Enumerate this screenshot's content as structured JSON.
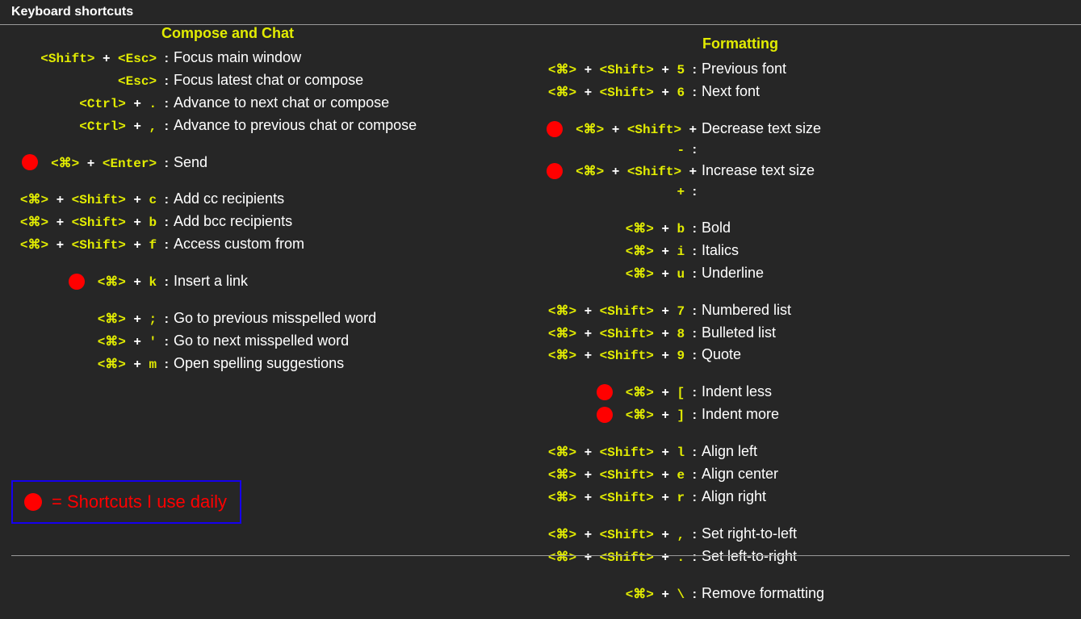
{
  "header": {
    "title": "Keyboard shortcuts"
  },
  "legend": {
    "text": "= Shortcuts I use daily"
  },
  "compose": {
    "title": "Compose and Chat",
    "g1": [
      {
        "daily": false,
        "keys": [
          "<Shift>",
          "<Esc>"
        ],
        "desc": "Focus main window"
      },
      {
        "daily": false,
        "keys": [
          "<Esc>"
        ],
        "desc": "Focus latest chat or compose"
      },
      {
        "daily": false,
        "keys": [
          "<Ctrl>",
          "."
        ],
        "desc": "Advance to next chat or compose"
      },
      {
        "daily": false,
        "keys": [
          "<Ctrl>",
          ","
        ],
        "desc": "Advance to previous chat or compose"
      }
    ],
    "g2": [
      {
        "daily": true,
        "keys": [
          "<⌘>",
          "<Enter>"
        ],
        "desc": "Send"
      }
    ],
    "g3": [
      {
        "daily": false,
        "keys": [
          "<⌘>",
          "<Shift>",
          "c"
        ],
        "desc": "Add cc recipients"
      },
      {
        "daily": false,
        "keys": [
          "<⌘>",
          "<Shift>",
          "b"
        ],
        "desc": "Add bcc recipients"
      },
      {
        "daily": false,
        "keys": [
          "<⌘>",
          "<Shift>",
          "f"
        ],
        "desc": "Access custom from"
      }
    ],
    "g4": [
      {
        "daily": true,
        "keys": [
          "<⌘>",
          "k"
        ],
        "desc": "Insert a link"
      }
    ],
    "g5": [
      {
        "daily": false,
        "keys": [
          "<⌘>",
          ";"
        ],
        "desc": "Go to previous misspelled word"
      },
      {
        "daily": false,
        "keys": [
          "<⌘>",
          "'"
        ],
        "desc": "Go to next misspelled word"
      },
      {
        "daily": false,
        "keys": [
          "<⌘>",
          "m"
        ],
        "desc": "Open spelling suggestions"
      }
    ]
  },
  "formatting": {
    "title": "Formatting",
    "g1": [
      {
        "daily": false,
        "keys": [
          "<⌘>",
          "<Shift>",
          "5"
        ],
        "desc": "Previous font"
      },
      {
        "daily": false,
        "keys": [
          "<⌘>",
          "<Shift>",
          "6"
        ],
        "desc": "Next font"
      }
    ],
    "g2": [
      {
        "daily": true,
        "keys": [
          "<⌘>",
          "<Shift>",
          "-"
        ],
        "desc": "Decrease text size"
      },
      {
        "daily": true,
        "keys": [
          "<⌘>",
          "<Shift>",
          "+"
        ],
        "desc": "Increase text size"
      }
    ],
    "g3": [
      {
        "daily": false,
        "keys": [
          "<⌘>",
          "b"
        ],
        "desc": "Bold"
      },
      {
        "daily": false,
        "keys": [
          "<⌘>",
          "i"
        ],
        "desc": "Italics"
      },
      {
        "daily": false,
        "keys": [
          "<⌘>",
          "u"
        ],
        "desc": "Underline"
      }
    ],
    "g4": [
      {
        "daily": false,
        "keys": [
          "<⌘>",
          "<Shift>",
          "7"
        ],
        "desc": "Numbered list"
      },
      {
        "daily": false,
        "keys": [
          "<⌘>",
          "<Shift>",
          "8"
        ],
        "desc": "Bulleted list"
      },
      {
        "daily": false,
        "keys": [
          "<⌘>",
          "<Shift>",
          "9"
        ],
        "desc": "Quote"
      }
    ],
    "g5": [
      {
        "daily": true,
        "keys": [
          "<⌘>",
          "["
        ],
        "desc": "Indent less"
      },
      {
        "daily": true,
        "keys": [
          "<⌘>",
          "]"
        ],
        "desc": "Indent more"
      }
    ],
    "g6": [
      {
        "daily": false,
        "keys": [
          "<⌘>",
          "<Shift>",
          "l"
        ],
        "desc": "Align left"
      },
      {
        "daily": false,
        "keys": [
          "<⌘>",
          "<Shift>",
          "e"
        ],
        "desc": "Align center"
      },
      {
        "daily": false,
        "keys": [
          "<⌘>",
          "<Shift>",
          "r"
        ],
        "desc": "Align right"
      }
    ],
    "g7": [
      {
        "daily": false,
        "keys": [
          "<⌘>",
          "<Shift>",
          ","
        ],
        "desc": "Set right-to-left"
      },
      {
        "daily": false,
        "keys": [
          "<⌘>",
          "<Shift>",
          "."
        ],
        "desc": "Set left-to-right"
      }
    ],
    "g8": [
      {
        "daily": false,
        "keys": [
          "<⌘>",
          "\\"
        ],
        "desc": "Remove formatting"
      }
    ]
  }
}
